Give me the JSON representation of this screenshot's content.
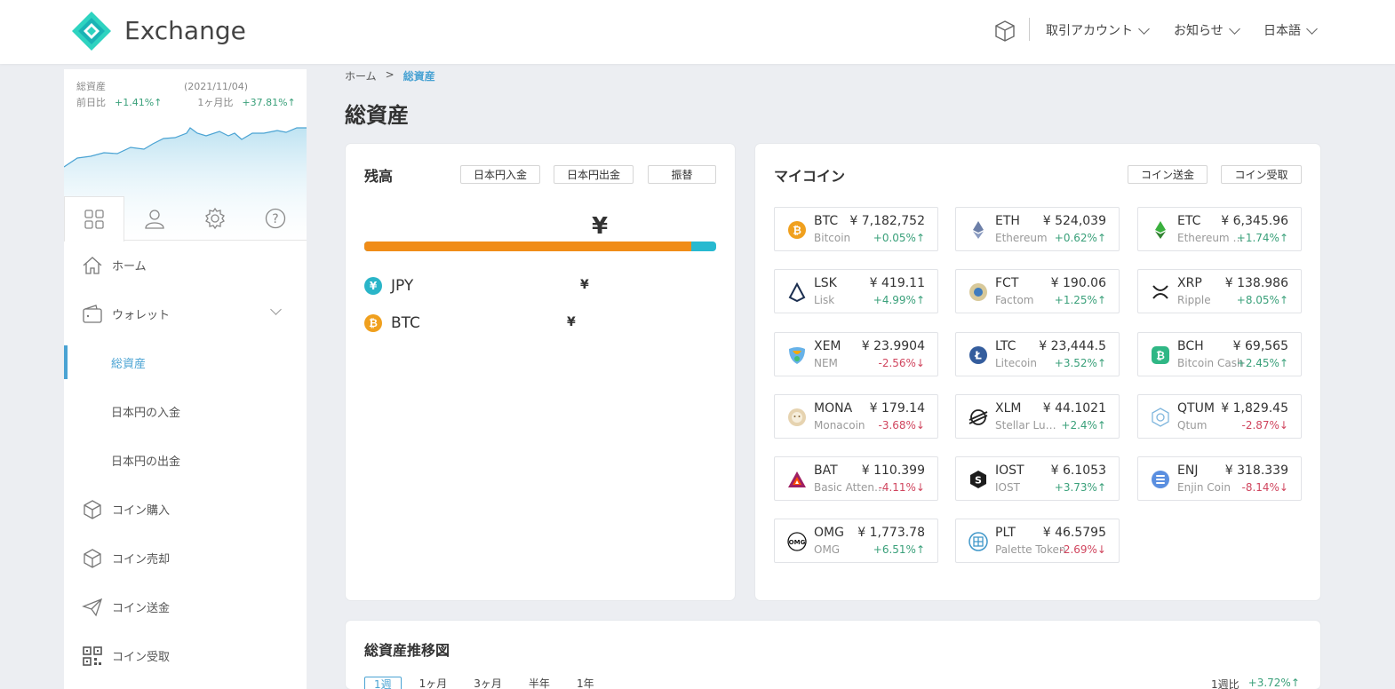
{
  "header": {
    "brand": "Exchange",
    "menu": [
      {
        "label": "取引アカウント"
      },
      {
        "label": "お知らせ"
      },
      {
        "label": "日本語"
      }
    ]
  },
  "sidebar": {
    "summary": {
      "label": "総資産",
      "date": "(2021/11/04)",
      "day_label": "前日比",
      "day_change": "+1.41%↑",
      "month_label": "1ヶ月比",
      "month_change": "+37.81%↑"
    },
    "nav": [
      {
        "label": "ホーム"
      },
      {
        "label": "ウォレット"
      },
      {
        "label": "総資産"
      },
      {
        "label": "日本円の入金"
      },
      {
        "label": "日本円の出金"
      },
      {
        "label": "コイン購入"
      },
      {
        "label": "コイン売却"
      },
      {
        "label": "コイン送金"
      },
      {
        "label": "コイン受取"
      }
    ]
  },
  "breadcrumb": {
    "home": "ホーム",
    "sep": ">",
    "current": "総資産"
  },
  "page_title": "総資産",
  "balance": {
    "title": "残高",
    "buttons": [
      "日本円入金",
      "日本円出金",
      "振替"
    ],
    "total_symbol": "¥",
    "jpy_share": 0.93,
    "rows": [
      {
        "label": "JPY",
        "value": "¥",
        "icon": "¥",
        "color": "#2ab5c8"
      },
      {
        "label": "BTC",
        "value": "¥",
        "icon": "₿",
        "color": "#f0a01e"
      }
    ]
  },
  "mycoin": {
    "title": "マイコイン",
    "buttons": [
      "コイン送金",
      "コイン受取"
    ],
    "coins": [
      {
        "sym": "BTC",
        "name": "Bitcoin",
        "price": "¥ 7,182,752",
        "change": "+0.05%↑",
        "dir": "up",
        "icon": "btc-icon"
      },
      {
        "sym": "ETH",
        "name": "Ethereum",
        "price": "¥ 524,039",
        "change": "+0.62%↑",
        "dir": "up",
        "icon": "eth-icon"
      },
      {
        "sym": "ETC",
        "name": "Ethereum Cl...",
        "price": "¥ 6,345.96",
        "change": "+1.74%↑",
        "dir": "up",
        "icon": "etc-icon"
      },
      {
        "sym": "LSK",
        "name": "Lisk",
        "price": "¥ 419.11",
        "change": "+4.99%↑",
        "dir": "up",
        "icon": "lsk-icon"
      },
      {
        "sym": "FCT",
        "name": "Factom",
        "price": "¥ 190.06",
        "change": "+1.25%↑",
        "dir": "up",
        "icon": "fct-icon"
      },
      {
        "sym": "XRP",
        "name": "Ripple",
        "price": "¥ 138.986",
        "change": "+8.05%↑",
        "dir": "up",
        "icon": "xrp-icon"
      },
      {
        "sym": "XEM",
        "name": "NEM",
        "price": "¥ 23.9904",
        "change": "-2.56%↓",
        "dir": "down",
        "icon": "xem-icon"
      },
      {
        "sym": "LTC",
        "name": "Litecoin",
        "price": "¥ 23,444.5",
        "change": "+3.52%↑",
        "dir": "up",
        "icon": "ltc-icon"
      },
      {
        "sym": "BCH",
        "name": "Bitcoin Cash",
        "price": "¥ 69,565",
        "change": "+2.45%↑",
        "dir": "up",
        "icon": "bch-icon"
      },
      {
        "sym": "MONA",
        "name": "Monacoin",
        "price": "¥ 179.14",
        "change": "-3.68%↓",
        "dir": "down",
        "icon": "mona-icon"
      },
      {
        "sym": "XLM",
        "name": "Stellar Lume...",
        "price": "¥ 44.1021",
        "change": "+2.4%↑",
        "dir": "up",
        "icon": "xlm-icon"
      },
      {
        "sym": "QTUM",
        "name": "Qtum",
        "price": "¥ 1,829.45",
        "change": "-2.87%↓",
        "dir": "down",
        "icon": "qtum-icon"
      },
      {
        "sym": "BAT",
        "name": "Basic Attenti...",
        "price": "¥ 110.399",
        "change": "-4.11%↓",
        "dir": "down",
        "icon": "bat-icon"
      },
      {
        "sym": "IOST",
        "name": "IOST",
        "price": "¥ 6.1053",
        "change": "+3.73%↑",
        "dir": "up",
        "icon": "iost-icon"
      },
      {
        "sym": "ENJ",
        "name": "Enjin Coin",
        "price": "¥ 318.339",
        "change": "-8.14%↓",
        "dir": "down",
        "icon": "enj-icon"
      },
      {
        "sym": "OMG",
        "name": "OMG",
        "price": "¥ 1,773.78",
        "change": "+6.51%↑",
        "dir": "up",
        "icon": "omg-icon"
      },
      {
        "sym": "PLT",
        "name": "Palette Token",
        "price": "¥ 46.5795",
        "change": "-2.69%↓",
        "dir": "down",
        "icon": "plt-icon"
      }
    ]
  },
  "history": {
    "title": "総資産推移図",
    "periods": [
      "1週",
      "1ヶ月",
      "3ヶ月",
      "半年",
      "1年"
    ],
    "week_label": "1週比",
    "week_change": "+3.72%↑"
  },
  "colors": {
    "accent": "#4aa3d3",
    "up": "#3aa07a",
    "down": "#d0455e",
    "orange": "#f08c18",
    "teal": "#27b9d0"
  }
}
